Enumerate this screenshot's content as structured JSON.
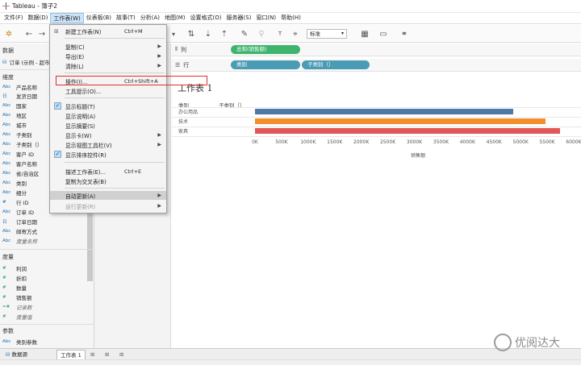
{
  "titlebar": {
    "title": "Tableau - 簿子2"
  },
  "menubar": {
    "items": [
      "文件(F)",
      "数据(D)",
      "工作表(W)",
      "仪表板(B)",
      "故事(T)",
      "分析(A)",
      "地图(M)",
      "设置格式(O)",
      "服务器(S)",
      "窗口(N)",
      "帮助(H)"
    ]
  },
  "toolbar": {
    "size_select": "标准"
  },
  "datapane": {
    "header": "数据",
    "datasource": "订单 (示例 - 超市)",
    "dimensions_header": "维度",
    "dimensions": [
      "产品名称",
      "发货日期",
      "国家",
      "地区",
      "城市",
      "子类别",
      "子类别（）",
      "客户 ID",
      "客户名称",
      "省/自治区",
      "类别",
      "细分",
      "行 ID",
      "订单 ID",
      "订单日期",
      "邮寄方式",
      "度量名称"
    ],
    "dimension_types": [
      "Abc",
      "日",
      "Abc",
      "Abc",
      "Abc",
      "Abc",
      "Abc",
      "Abc",
      "Abc",
      "Abc",
      "Abc",
      "Abc",
      "#",
      "Abc",
      "日",
      "Abc",
      "Abc"
    ],
    "measures_header": "度量",
    "measures": [
      "利润",
      "折扣",
      "数量",
      "销售额",
      "记录数",
      "度量值"
    ],
    "params_header": "参数",
    "params": [
      "类别参数"
    ]
  },
  "shelves": {
    "columns_label": "列",
    "rows_label": "行",
    "columns_pill": "总和(销售额)",
    "rows_pill_1": "类别",
    "rows_pill_2": "子类别（）"
  },
  "worksheet": {
    "title": "工作表 1",
    "header_category": "类别",
    "header_subcategory": "子类别（）",
    "axis_title": "销售额"
  },
  "chart_data": {
    "type": "bar",
    "orientation": "horizontal",
    "categories": [
      "办公用品",
      "技术",
      "家具"
    ],
    "values": [
      4865000,
      5470000,
      5735000
    ],
    "colors": [
      "#4e79a7",
      "#f28e2b",
      "#e15759"
    ],
    "xlim": [
      0,
      6000000
    ],
    "ticks": [
      "0K",
      "500K",
      "1000K",
      "1500K",
      "2000K",
      "2500K",
      "3000K",
      "3500K",
      "4000K",
      "4500K",
      "5000K",
      "5500K",
      "6000K"
    ],
    "xlabel": "销售额"
  },
  "tabs": {
    "datasource": "数据源",
    "sheet1": "工作表 1"
  },
  "dropdown": {
    "items": [
      {
        "label": "新建工作表(N)",
        "shortcut": "Ctrl+M",
        "icon": "new-sheet-icon"
      },
      {
        "label": "复制(C)",
        "arrow": true
      },
      {
        "label": "导出(E)",
        "arrow": true
      },
      {
        "label": "清除(L)",
        "arrow": true
      },
      {
        "label": "操作(I)...",
        "shortcut": "Ctrl+Shift+A"
      },
      {
        "label": "工具提示(O)..."
      },
      {
        "label": "显示标题(T)",
        "checked": true
      },
      {
        "label": "显示说明(A)"
      },
      {
        "label": "显示摘要(S)"
      },
      {
        "label": "显示卡(W)",
        "arrow": true
      },
      {
        "label": "显示视图工具栏(V)",
        "arrow": true
      },
      {
        "label": "显示排序控件(R)",
        "checked": true
      },
      {
        "label": "描述工作表(E)...",
        "shortcut": "Ctrl+E"
      },
      {
        "label": "复制为交叉表(B)"
      },
      {
        "label": "自动更新(A)",
        "arrow": true
      },
      {
        "label": "运行更新(R)",
        "arrow": true,
        "disabled": true
      }
    ]
  },
  "watermark": {
    "text": "优阅达大"
  },
  "colors": {
    "accent_pill_green": "#3fb46e",
    "accent_pill_teal": "#4a9bb4",
    "highlight_red": "#e03030"
  }
}
